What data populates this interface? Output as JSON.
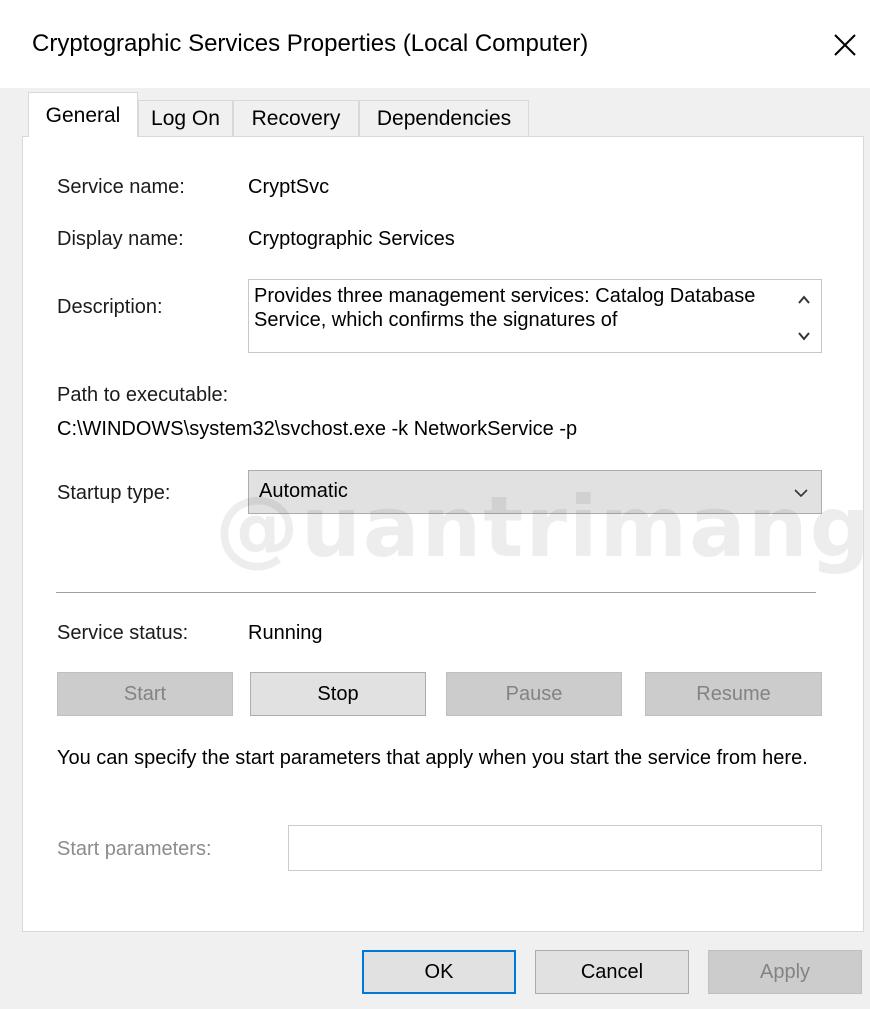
{
  "window": {
    "title": "Cryptographic Services Properties (Local Computer)"
  },
  "tabs": [
    {
      "label": "General"
    },
    {
      "label": "Log On"
    },
    {
      "label": "Recovery"
    },
    {
      "label": "Dependencies"
    }
  ],
  "general": {
    "service_name_label": "Service name:",
    "service_name": "CryptSvc",
    "display_name_label": "Display name:",
    "display_name": "Cryptographic Services",
    "description_label": "Description:",
    "description": "Provides three management services: Catalog Database Service, which confirms the signatures of",
    "path_label": "Path to executable:",
    "path": "C:\\WINDOWS\\system32\\svchost.exe -k NetworkService -p",
    "startup_type_label": "Startup type:",
    "startup_type": "Automatic",
    "service_status_label": "Service status:",
    "service_status": "Running",
    "buttons": {
      "start": "Start",
      "stop": "Stop",
      "pause": "Pause",
      "resume": "Resume"
    },
    "info_text": "You can specify the start parameters that apply when you start the service from here.",
    "start_parameters_label": "Start parameters:",
    "start_parameters_value": ""
  },
  "footer": {
    "ok": "OK",
    "cancel": "Cancel",
    "apply": "Apply"
  },
  "watermark": "@uantrimang",
  "colors": {
    "accent": "#0078d7",
    "disabled_text": "#838383",
    "dialog_bg": "#f0f0f0"
  }
}
